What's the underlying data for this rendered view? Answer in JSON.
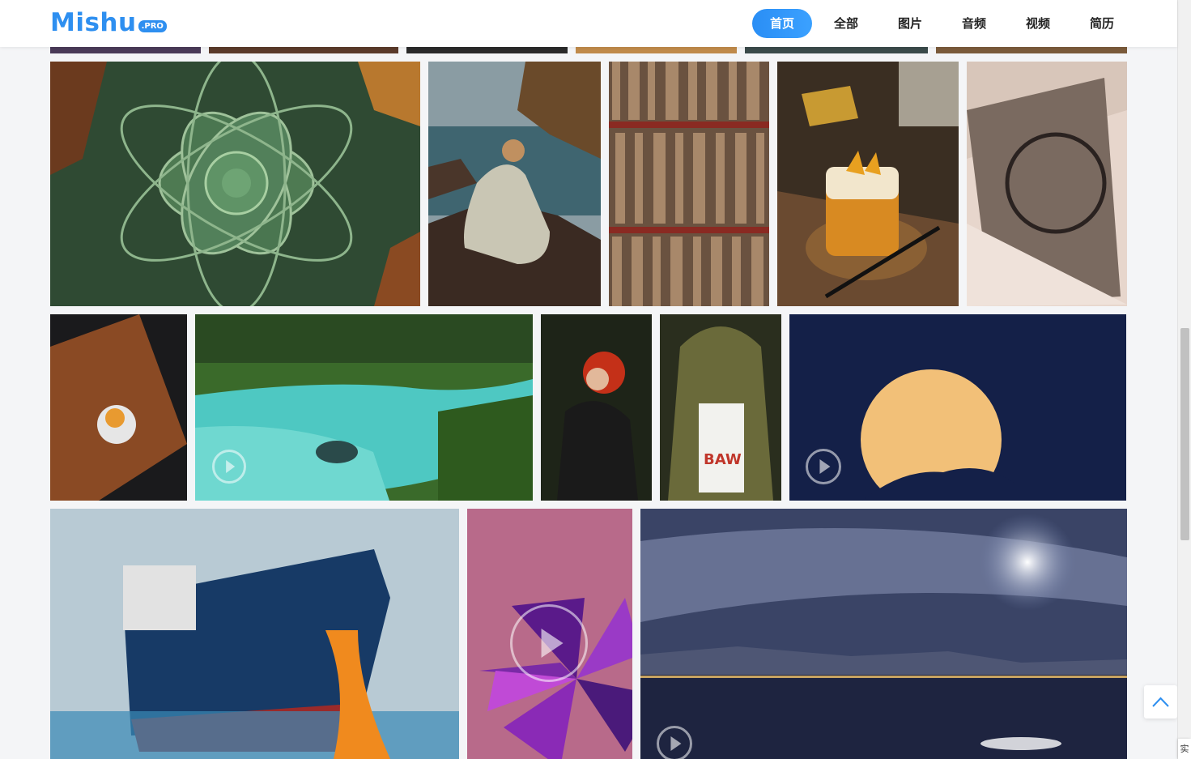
{
  "brand": {
    "name": "Mishu",
    "badge": ".PRO",
    "color": "#2e8ff0"
  },
  "nav": {
    "items": [
      {
        "label": "首页",
        "active": true
      },
      {
        "label": "全部",
        "active": false
      },
      {
        "label": "图片",
        "active": false
      },
      {
        "label": "音频",
        "active": false
      },
      {
        "label": "视频",
        "active": false
      },
      {
        "label": "简历",
        "active": false
      }
    ]
  },
  "gallery": {
    "items": [
      {
        "name": "photo-succulent",
        "kind": "image",
        "subject": "succulent"
      },
      {
        "name": "photo-woman-on-rocks",
        "kind": "image",
        "subject": "woman sitting on rocks by the sea"
      },
      {
        "name": "photo-vinyl-shelves",
        "kind": "image",
        "subject": "record shelves"
      },
      {
        "name": "photo-dessert-glass",
        "kind": "image",
        "subject": "dessert in glass"
      },
      {
        "name": "photo-vintage-car",
        "kind": "image",
        "subject": "vintage car interior"
      },
      {
        "name": "photo-drink-on-table",
        "kind": "image",
        "subject": "drink on wooden table"
      },
      {
        "name": "video-turquoise-river",
        "kind": "video",
        "subject": "turquoise river"
      },
      {
        "name": "photo-red-hair-woman",
        "kind": "image",
        "subject": "woman with red hair"
      },
      {
        "name": "photo-hooded-person",
        "kind": "image",
        "subject": "person with hood"
      },
      {
        "name": "video-full-moon",
        "kind": "video",
        "subject": "full moon"
      },
      {
        "name": "photo-ship-bow",
        "kind": "image",
        "subject": "ship bow with ropes"
      },
      {
        "name": "video-purple-abstract",
        "kind": "video",
        "subject": "purple abstract"
      },
      {
        "name": "video-night-lake",
        "kind": "video",
        "subject": "moon over night lake"
      }
    ]
  },
  "back_to_top": {
    "icon": "chevron-up-icon"
  },
  "corner_label": "实"
}
